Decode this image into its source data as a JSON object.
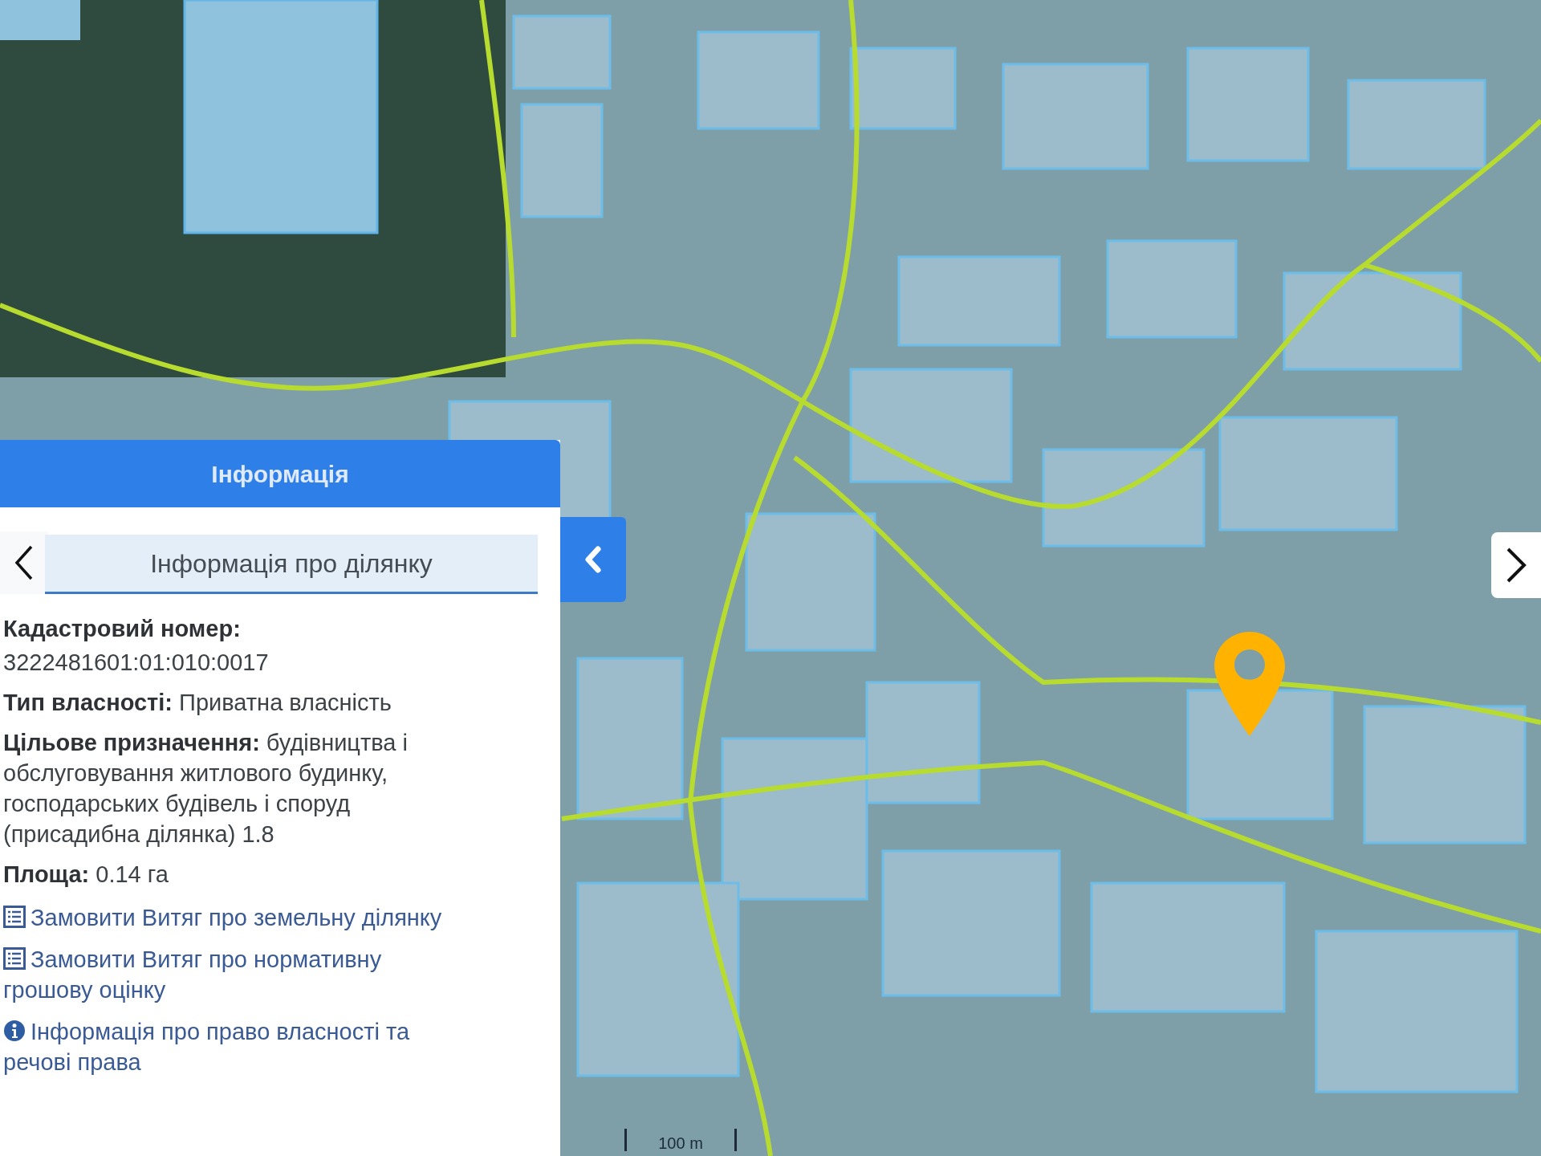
{
  "panel": {
    "title": "Інформація",
    "subtitle": "Інформація про ділянку",
    "fields": [
      {
        "kind": "block",
        "label": "Кадастровий номер:",
        "value": "3222481601:01:010:0017"
      },
      {
        "kind": "inline",
        "label": "Тип власності:",
        "value": "Приватна власність"
      },
      {
        "kind": "inline",
        "label": "Цільове призначення:",
        "value": "будівництва і обслуговування житлового будинку, господарських будівель і споруд (присадибна ділянка) 1.8"
      },
      {
        "kind": "inline",
        "label": "Площа:",
        "value": "0.14 га"
      }
    ],
    "links": [
      {
        "kind": "document",
        "text": "Замовити Витяг про земельну ділянку"
      },
      {
        "kind": "document",
        "text": "Замовити Витяг про нормативну грошову оцінку"
      },
      {
        "kind": "info",
        "text": "Інформація про право власності та речові права"
      }
    ]
  },
  "map": {
    "scale_label": "100 m"
  }
}
